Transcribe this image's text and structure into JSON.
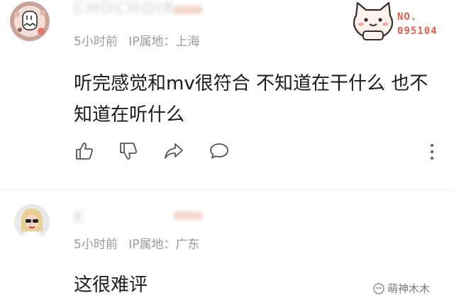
{
  "comments": [
    {
      "username": "CHOCHOIR",
      "time_ago": "5小时前",
      "ip_location": "IP属地：上海",
      "text_line1": "听完感觉和mv很符合 不知道在干什么 也不",
      "text_line2": "知道在听什么",
      "avatar_icon": "cartoon-face-avatar-icon"
    },
    {
      "username": "K",
      "time_ago": "5小时前",
      "ip_location": "IP属地：广东",
      "text_line1": "这很难评",
      "avatar_icon": "photo-avatar-icon"
    }
  ],
  "actions": [
    "thumbs-up-icon",
    "thumbs-down-icon",
    "share-icon",
    "comment-icon",
    "more-icon"
  ],
  "sticker": {
    "label_line1": "NO.",
    "label_line2": "095104"
  },
  "watermark": {
    "text": "萌神木木"
  },
  "colors": {
    "text": "#1a1a1a",
    "meta": "#9a9a9a",
    "accent": "#e0604e"
  }
}
